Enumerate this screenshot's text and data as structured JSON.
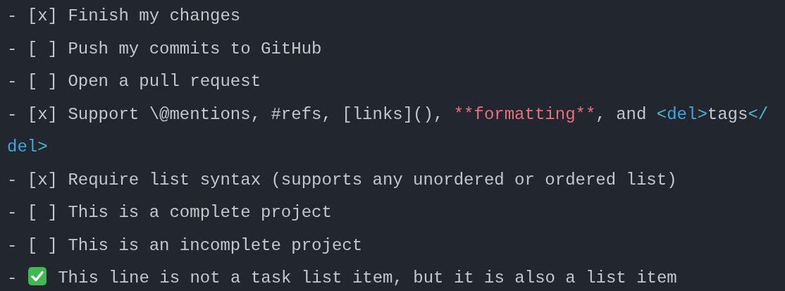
{
  "editor": {
    "lines": [
      {
        "segments": [
          {
            "kind": "text",
            "text": "- [x] Finish my changes"
          }
        ]
      },
      {
        "segments": [
          {
            "kind": "text",
            "text": "- [ ] Push my commits to GitHub"
          }
        ]
      },
      {
        "segments": [
          {
            "kind": "text",
            "text": "- [ ] Open a pull request"
          }
        ]
      },
      {
        "segments": [
          {
            "kind": "text",
            "text": "- [x] Support \\@mentions, #refs, [links](), "
          },
          {
            "kind": "markup",
            "text": "**formatting**"
          },
          {
            "kind": "text",
            "text": ", and "
          },
          {
            "kind": "tag-bracket",
            "text": "<"
          },
          {
            "kind": "tag-name",
            "text": "del"
          },
          {
            "kind": "tag-bracket",
            "text": ">"
          },
          {
            "kind": "text",
            "text": "tags"
          },
          {
            "kind": "tag-bracket",
            "text": "</"
          }
        ]
      },
      {
        "segments": [
          {
            "kind": "tag-name",
            "text": "del"
          },
          {
            "kind": "tag-bracket",
            "text": ">"
          }
        ]
      },
      {
        "segments": [
          {
            "kind": "text",
            "text": "- [x] Require list syntax (supports any unordered or ordered list)"
          }
        ]
      },
      {
        "segments": [
          {
            "kind": "text",
            "text": "- [ ] This is a complete project"
          }
        ]
      },
      {
        "segments": [
          {
            "kind": "text",
            "text": "- [ ] This is an incomplete project"
          }
        ]
      },
      {
        "segments": [
          {
            "kind": "text",
            "text": "- "
          },
          {
            "kind": "check-emoji"
          },
          {
            "kind": "text",
            "text": " This line is not a task list item, but it is also a list item"
          }
        ]
      }
    ]
  }
}
